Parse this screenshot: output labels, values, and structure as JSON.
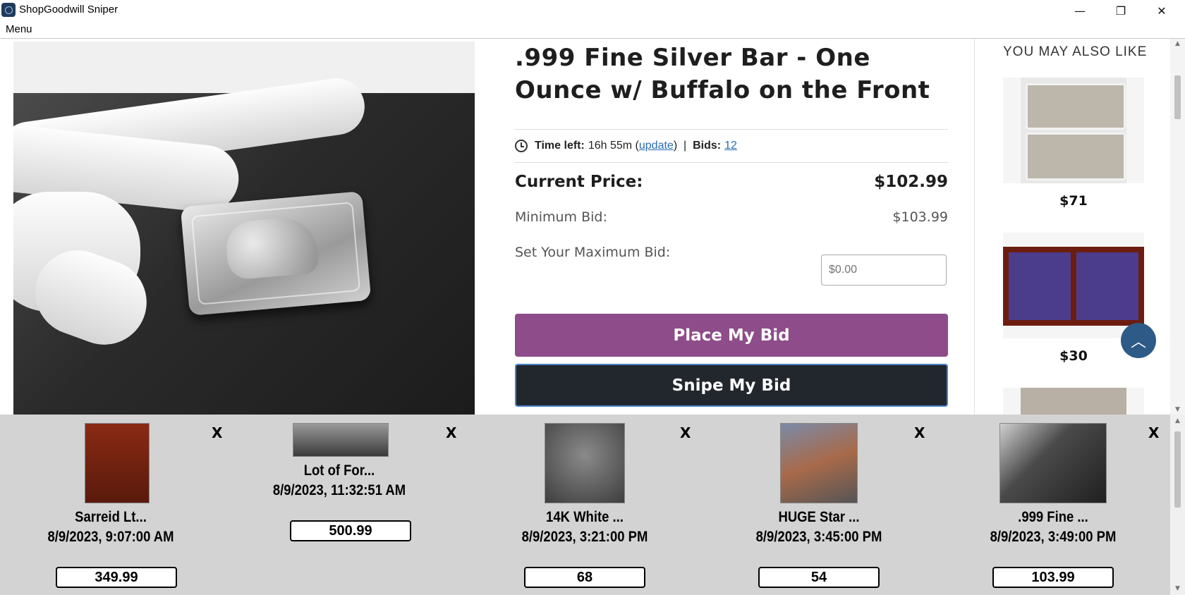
{
  "window": {
    "title": "ShopGoodwill Sniper",
    "controls": {
      "minimize": "—",
      "maximize": "❐",
      "close": "✕"
    }
  },
  "menu": {
    "label": "Menu"
  },
  "product": {
    "title": ".999 Fine Silver Bar - One Ounce w/ Buffalo on the Front",
    "time_left_label": "Time left:",
    "time_left_value": "16h 55m",
    "update_link": "update",
    "bids_label": "Bids:",
    "bids_value": "12",
    "current_price_label": "Current Price:",
    "current_price_value": "$102.99",
    "minimum_bid_label": "Minimum Bid:",
    "minimum_bid_value": "$103.99",
    "max_bid_label": "Set Your Maximum Bid:",
    "max_bid_placeholder": "$0.00",
    "place_bid_label": "Place My Bid",
    "snipe_bid_label": "Snipe My Bid"
  },
  "sidebar": {
    "title": "YOU MAY ALSO LIKE",
    "items": [
      {
        "price": "$71"
      },
      {
        "price": "$30"
      }
    ]
  },
  "tracker": {
    "items": [
      {
        "name": "Sarreid Lt...",
        "end": "8/9/2023, 9:07:00 AM",
        "bid": "349.99",
        "remove": "X"
      },
      {
        "name": "Lot of For...",
        "end": "8/9/2023, 11:32:51 AM",
        "bid": "500.99",
        "remove": "X"
      },
      {
        "name": "14K White ...",
        "end": "8/9/2023, 3:21:00 PM",
        "bid": "68",
        "remove": "X"
      },
      {
        "name": "HUGE Star ...",
        "end": "8/9/2023, 3:45:00 PM",
        "bid": "54",
        "remove": "X"
      },
      {
        "name": ".999 Fine ...",
        "end": "8/9/2023, 3:49:00 PM",
        "bid": "103.99",
        "remove": "X"
      }
    ]
  },
  "colors": {
    "place_bid": "#8e4c8a",
    "snipe_bid": "#22272d",
    "scroll_top": "#2d5a87",
    "tracker_bg": "#d3d3d3"
  }
}
